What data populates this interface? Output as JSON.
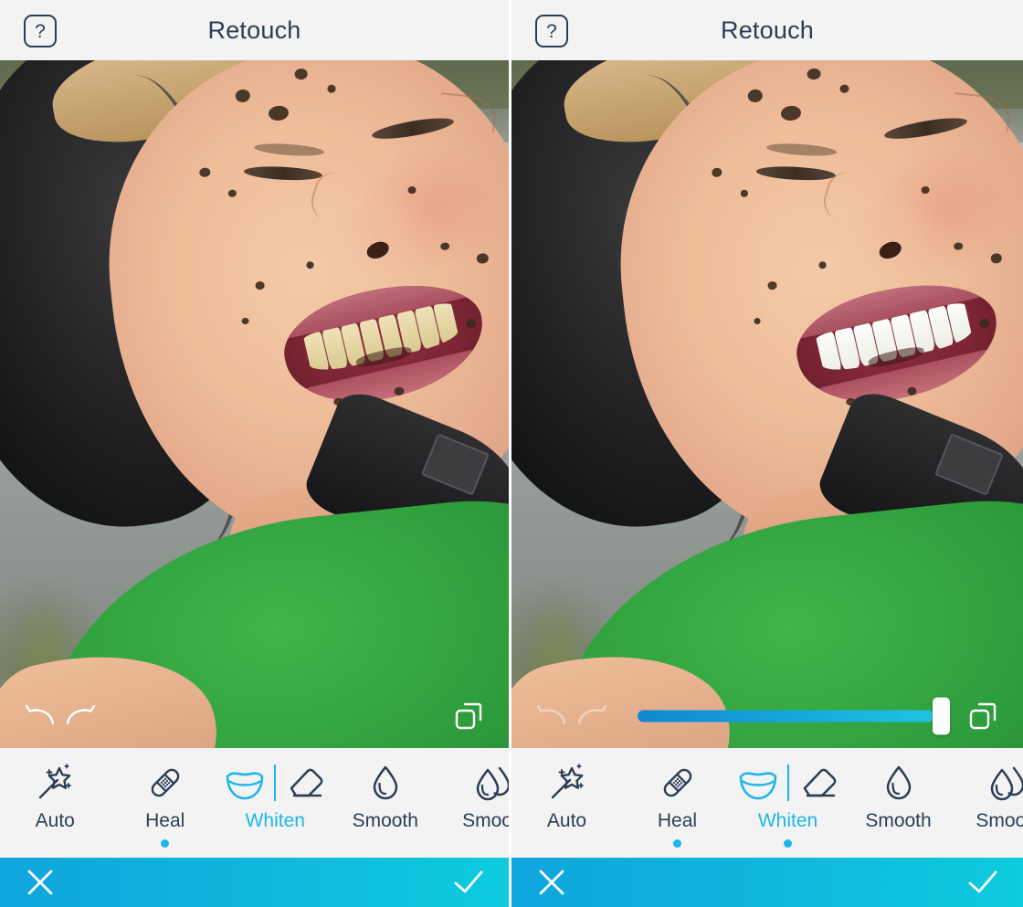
{
  "app": {
    "screen_title": "Retouch",
    "accent_color": "#1cb7e8",
    "icon_color": "#2b3e55",
    "header_bg": "#f3f3f3",
    "actionbar_gradient_start": "#0fa5dd",
    "actionbar_gradient_end": "#0ecbdd"
  },
  "header": {
    "help_label": "?",
    "help_icon": "question-mark-icon",
    "title": "Retouch"
  },
  "photo": {
    "subject": "boy in black helmet laughing, muddy face, green shirt, lake background",
    "left_state": "before whitening — teeth yellowish",
    "right_state": "after whitening — teeth brightened"
  },
  "photo_controls": {
    "undo_icon": "undo-arrow-icon",
    "redo_icon": "redo-arrow-icon",
    "compare_icon": "compare-layers-icon"
  },
  "slider": {
    "visible_on": "right",
    "value_percent": 100,
    "track_gradient_start": "#1286d0",
    "track_gradient_end": "#1fc4e0",
    "handle_color": "#fbfbfb"
  },
  "tools": {
    "left": [
      {
        "label": "Auto",
        "icon": "magic-wand-icon",
        "active": false,
        "dot": false
      },
      {
        "label": "Heal",
        "icon": "bandage-icon",
        "active": false,
        "dot": true
      },
      {
        "label": "Whiten",
        "icon": "teeth-smile-icon",
        "active": true,
        "dot": false
      },
      {
        "label": "Smooth",
        "icon": "water-drop-icon",
        "active": false,
        "dot": false
      },
      {
        "label": "Smooth",
        "icon": "double-drop-icon",
        "active": false,
        "dot": false
      }
    ],
    "right": [
      {
        "label": "Auto",
        "icon": "magic-wand-icon",
        "active": false,
        "dot": false
      },
      {
        "label": "Heal",
        "icon": "bandage-icon",
        "active": false,
        "dot": true
      },
      {
        "label": "Whiten",
        "icon": "teeth-smile-icon",
        "active": true,
        "dot": true
      },
      {
        "label": "Smooth",
        "icon": "water-drop-icon",
        "active": false,
        "dot": false
      },
      {
        "label": "Smooth",
        "icon": "double-drop-icon",
        "active": false,
        "dot": false
      }
    ]
  },
  "actionbar": {
    "cancel_icon": "close-x-icon",
    "confirm_icon": "checkmark-icon"
  }
}
